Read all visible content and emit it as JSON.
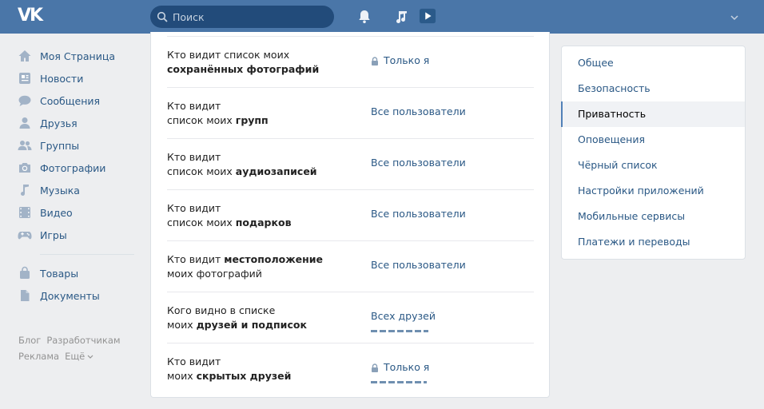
{
  "header": {
    "logo": "VK",
    "search_placeholder": "Поиск"
  },
  "leftnav": {
    "items": [
      {
        "label": "Моя Страница",
        "icon": "home-icon"
      },
      {
        "label": "Новости",
        "icon": "news-icon"
      },
      {
        "label": "Сообщения",
        "icon": "messages-icon"
      },
      {
        "label": "Друзья",
        "icon": "friends-icon"
      },
      {
        "label": "Группы",
        "icon": "groups-icon"
      },
      {
        "label": "Фотографии",
        "icon": "camera-icon"
      },
      {
        "label": "Музыка",
        "icon": "music-icon"
      },
      {
        "label": "Видео",
        "icon": "video-icon"
      },
      {
        "label": "Игры",
        "icon": "gamepad-icon"
      }
    ],
    "items2": [
      {
        "label": "Товары",
        "icon": "bag-icon"
      },
      {
        "label": "Документы",
        "icon": "document-icon"
      }
    ],
    "footer": [
      "Блог",
      "Разработчикам",
      "Реклама",
      "Ещё"
    ]
  },
  "privacy": {
    "rows": [
      {
        "q1": "Кто видит список моих ",
        "q2": "",
        "b": "сохранённых фотографий",
        "value": "Только я",
        "locked": true,
        "dashed": false
      },
      {
        "q1": "Кто видит",
        "q2": "список моих ",
        "b": "групп",
        "value": "Все пользователи",
        "locked": false,
        "dashed": false
      },
      {
        "q1": "Кто видит",
        "q2": "список моих ",
        "b": "аудиозаписей",
        "value": "Все пользователи",
        "locked": false,
        "dashed": false
      },
      {
        "q1": "Кто видит",
        "q2": "список моих ",
        "b": "подарков",
        "value": "Все пользователи",
        "locked": false,
        "dashed": false
      },
      {
        "q1": "Кто видит ",
        "b1": "местоположение",
        "q2": "моих фотографий",
        "value": "Все пользователи",
        "locked": false,
        "dashed": false
      },
      {
        "q1": "Кого видно в списке",
        "q2": "моих ",
        "b": "друзей и подписок",
        "value": "Всех друзей",
        "locked": false,
        "dashed": true
      },
      {
        "q1": "Кто видит",
        "q2": "моих ",
        "b": "скрытых друзей",
        "value": "Только я",
        "locked": true,
        "dashed": true
      }
    ]
  },
  "rightmenu": {
    "items": [
      "Общее",
      "Безопасность",
      "Приватность",
      "Оповещения",
      "Чёрный список",
      "Настройки приложений",
      "Мобильные сервисы",
      "Платежи и переводы"
    ],
    "active": "Приватность"
  },
  "colors": {
    "header_bg": "#4a76a8",
    "link": "#2a5885",
    "active_marker": "#5181b8"
  }
}
